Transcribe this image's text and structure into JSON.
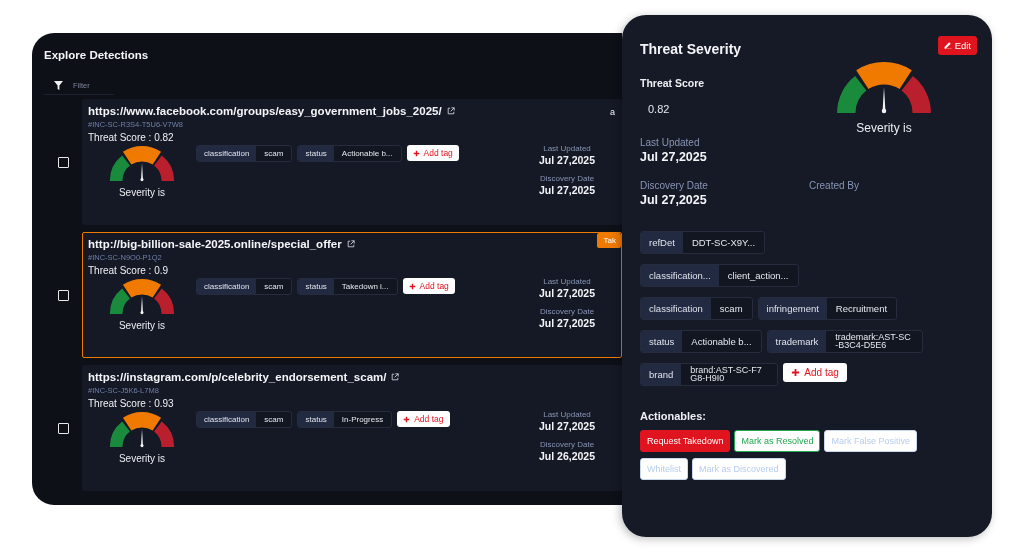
{
  "detections": {
    "title": "Explore Detections",
    "filter": {
      "placeholder": "Filter"
    },
    "cut_text": "a",
    "rows": [
      {
        "selected": false,
        "checked": false,
        "url": "https://www.facebook.com/groups/easy_government_jobs_2025/",
        "incident_id": "#INC-SC-R3S4-T5U6-V7W8",
        "threat_score": "Threat Score : 0.82",
        "gauge_label": "Severity is",
        "tags": [
          {
            "key": "classification",
            "value": "scam"
          },
          {
            "key": "status",
            "value": "Actionable b..."
          }
        ],
        "add_tag": "Add tag",
        "last_updated_label": "Last Updated",
        "last_updated": "Jul 27,2025",
        "discovery_label": "Discovery Date",
        "discovery_date": "Jul 27,2025"
      },
      {
        "selected": true,
        "checked": false,
        "badge": "Tak",
        "url": "http://big-billion-sale-2025.online/special_offer",
        "incident_id": "#INC-SC-N9O0-P1Q2",
        "threat_score": "Threat Score : 0.9",
        "gauge_label": "Severity is",
        "tags": [
          {
            "key": "classification",
            "value": "scam"
          },
          {
            "key": "status",
            "value": "Takedown i..."
          }
        ],
        "add_tag": "Add tag",
        "last_updated_label": "Last Updated",
        "last_updated": "Jul 27,2025",
        "discovery_label": "Discovery Date",
        "discovery_date": "Jul 27,2025"
      },
      {
        "selected": false,
        "checked": false,
        "url": "https://instagram.com/p/celebrity_endorsement_scam/",
        "incident_id": "#INC-SC-J5K6-L7M8",
        "threat_score": "Threat Score : 0.93",
        "gauge_label": "Severity is",
        "tags": [
          {
            "key": "classification",
            "value": "scam"
          },
          {
            "key": "status",
            "value": "In-Progress"
          }
        ],
        "add_tag": "Add tag",
        "last_updated_label": "Last Updated",
        "last_updated": "Jul 27,2025",
        "discovery_label": "Discovery Date",
        "discovery_date": "Jul 26,2025"
      }
    ]
  },
  "severity": {
    "title": "Threat Severity",
    "edit_button": "Edit",
    "threat_score_label": "Threat Score",
    "threat_score": "0.82",
    "gauge_label": "Severity is",
    "last_updated_label": "Last Updated",
    "last_updated": "Jul 27,2025",
    "discovery_label": "Discovery Date",
    "discovery_date": "Jul 27,2025",
    "created_by_label": "Created By",
    "tags": [
      {
        "key": "refDet",
        "value": "DDT-SC-X9Y..."
      },
      {
        "key": "classification...",
        "value": "client_action..."
      },
      {
        "key": "classification",
        "value": "scam"
      },
      {
        "key": "infringement",
        "value": "Recruitment"
      },
      {
        "key": "status",
        "value": "Actionable b..."
      },
      {
        "key": "trademark",
        "value": "trademark:AST-SC-B3C4-D5E6"
      },
      {
        "key": "brand",
        "value": "brand:AST-SC-F7G8-H9I0"
      }
    ],
    "add_tag": "Add tag",
    "actionables_label": "Actionables:",
    "actions": [
      {
        "label": "Request Takedown",
        "kind": "danger"
      },
      {
        "label": "Mark as Resolved",
        "kind": "success"
      },
      {
        "label": "Mark False Positive",
        "kind": "muted"
      },
      {
        "label": "Whitelist",
        "kind": "muted"
      },
      {
        "label": "Mark as Discovered",
        "kind": "muted"
      }
    ]
  }
}
